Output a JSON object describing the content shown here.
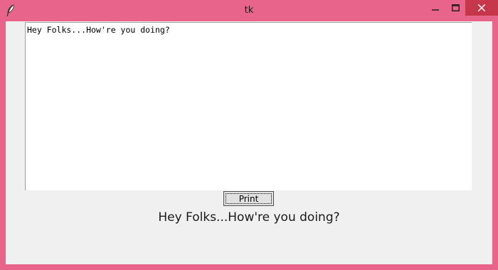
{
  "window": {
    "title": "tk",
    "frame_color": "#e8648a",
    "close_button_color": "#c7374c",
    "app_icon": "feather-icon",
    "controls": {
      "minimize_icon": "minimize-icon",
      "maximize_icon": "maximize-icon",
      "close_icon": "close-icon"
    }
  },
  "textbox": {
    "content": "Hey Folks...How're you doing?"
  },
  "print_button": {
    "label": "Print"
  },
  "output_label": {
    "text": "Hey Folks...How're you doing?"
  }
}
